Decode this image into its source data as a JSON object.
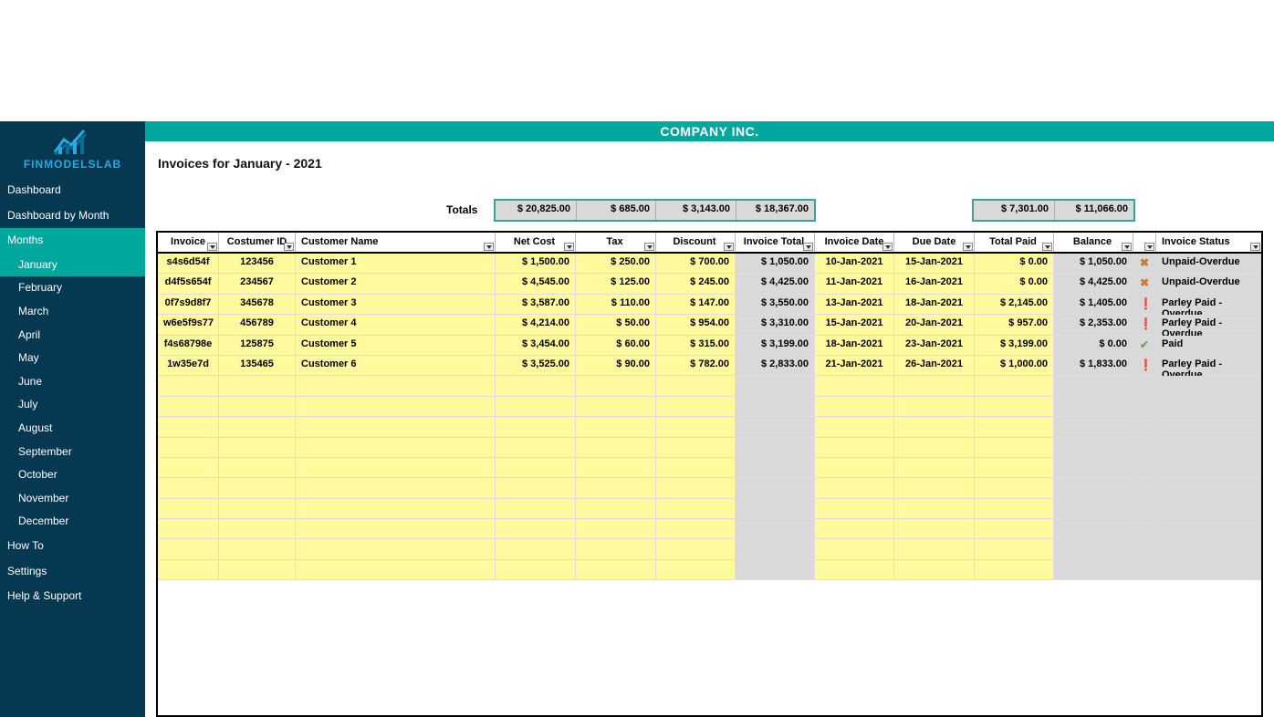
{
  "company": "COMPANY INC.",
  "logo_text": "FINMODELSLAB",
  "page_title": "Invoices for January - 2021",
  "sidebar": {
    "items": [
      {
        "label": "Dashboard",
        "active": false,
        "sub": false
      },
      {
        "label": "Dashboard by Month",
        "active": false,
        "sub": false
      },
      {
        "label": "Months",
        "active": true,
        "sub": false
      },
      {
        "label": "January",
        "active": true,
        "sub": true
      },
      {
        "label": "February",
        "active": false,
        "sub": true
      },
      {
        "label": "March",
        "active": false,
        "sub": true
      },
      {
        "label": "April",
        "active": false,
        "sub": true
      },
      {
        "label": "May",
        "active": false,
        "sub": true
      },
      {
        "label": "June",
        "active": false,
        "sub": true
      },
      {
        "label": "July",
        "active": false,
        "sub": true
      },
      {
        "label": "August",
        "active": false,
        "sub": true
      },
      {
        "label": "September",
        "active": false,
        "sub": true
      },
      {
        "label": "October",
        "active": false,
        "sub": true
      },
      {
        "label": "November",
        "active": false,
        "sub": true
      },
      {
        "label": "December",
        "active": false,
        "sub": true
      },
      {
        "label": "How To",
        "active": false,
        "sub": false
      },
      {
        "label": "Settings",
        "active": false,
        "sub": false
      },
      {
        "label": "Help & Support",
        "active": false,
        "sub": false
      }
    ]
  },
  "totals": {
    "label": "Totals",
    "net_cost": "$ 20,825.00",
    "tax": "$ 685.00",
    "discount": "$ 3,143.00",
    "invoice_total": "$ 18,367.00",
    "total_paid": "$ 7,301.00",
    "balance": "$ 11,066.00"
  },
  "columns": {
    "invoice": "Invoice",
    "customer_id": "Costumer ID",
    "customer_name": "Customer Name",
    "net_cost": "Net Cost",
    "tax": "Tax",
    "discount": "Discount",
    "invoice_total": "Invoice Total",
    "invoice_date": "Invoice Date",
    "due_date": "Due Date",
    "total_paid": "Total Paid",
    "balance": "Balance",
    "status_icon": "",
    "invoice_status": "Invoice Status"
  },
  "status_icons": {
    "unpaid-overdue": "✖",
    "parley-paid-overdue": "❗",
    "paid": "✔"
  },
  "rows": [
    {
      "invoice": "s4s6d54f",
      "customer_id": "123456",
      "customer_name": "Customer 1",
      "net_cost": "$ 1,500.00",
      "tax": "$ 250.00",
      "discount": "$ 700.00",
      "invoice_total": "$ 1,050.00",
      "invoice_date": "10-Jan-2021",
      "due_date": "15-Jan-2021",
      "total_paid": "$ 0.00",
      "balance": "$ 1,050.00",
      "status_key": "unpaid-overdue",
      "invoice_status": "Unpaid-Overdue"
    },
    {
      "invoice": "d4f5s654f",
      "customer_id": "234567",
      "customer_name": "Customer 2",
      "net_cost": "$ 4,545.00",
      "tax": "$ 125.00",
      "discount": "$ 245.00",
      "invoice_total": "$ 4,425.00",
      "invoice_date": "11-Jan-2021",
      "due_date": "16-Jan-2021",
      "total_paid": "$ 0.00",
      "balance": "$ 4,425.00",
      "status_key": "unpaid-overdue",
      "invoice_status": "Unpaid-Overdue"
    },
    {
      "invoice": "0f7s9d8f7",
      "customer_id": "345678",
      "customer_name": "Customer 3",
      "net_cost": "$ 3,587.00",
      "tax": "$ 110.00",
      "discount": "$ 147.00",
      "invoice_total": "$ 3,550.00",
      "invoice_date": "13-Jan-2021",
      "due_date": "18-Jan-2021",
      "total_paid": "$ 2,145.00",
      "balance": "$ 1,405.00",
      "status_key": "parley-paid-overdue",
      "invoice_status": "Parley Paid - Overdue"
    },
    {
      "invoice": "w6e5f9s77",
      "customer_id": "456789",
      "customer_name": "Customer 4",
      "net_cost": "$ 4,214.00",
      "tax": "$ 50.00",
      "discount": "$ 954.00",
      "invoice_total": "$ 3,310.00",
      "invoice_date": "15-Jan-2021",
      "due_date": "20-Jan-2021",
      "total_paid": "$ 957.00",
      "balance": "$ 2,353.00",
      "status_key": "parley-paid-overdue",
      "invoice_status": "Parley Paid - Overdue"
    },
    {
      "invoice": "f4s68798e",
      "customer_id": "125875",
      "customer_name": "Customer 5",
      "net_cost": "$ 3,454.00",
      "tax": "$ 60.00",
      "discount": "$ 315.00",
      "invoice_total": "$ 3,199.00",
      "invoice_date": "18-Jan-2021",
      "due_date": "23-Jan-2021",
      "total_paid": "$ 3,199.00",
      "balance": "$ 0.00",
      "status_key": "paid",
      "invoice_status": "Paid"
    },
    {
      "invoice": "1w35e7d",
      "customer_id": "135465",
      "customer_name": "Customer 6",
      "net_cost": "$ 3,525.00",
      "tax": "$ 90.00",
      "discount": "$ 782.00",
      "invoice_total": "$ 2,833.00",
      "invoice_date": "21-Jan-2021",
      "due_date": "26-Jan-2021",
      "total_paid": "$ 1,000.00",
      "balance": "$ 1,833.00",
      "status_key": "parley-paid-overdue",
      "invoice_status": "Parley Paid - Overdue"
    }
  ],
  "empty_rows": 10,
  "colors": {
    "accent": "#00a79d",
    "sidebar_bg": "#063852",
    "row_yellow": "#fffa9e",
    "row_grey": "#d9d9d9"
  }
}
